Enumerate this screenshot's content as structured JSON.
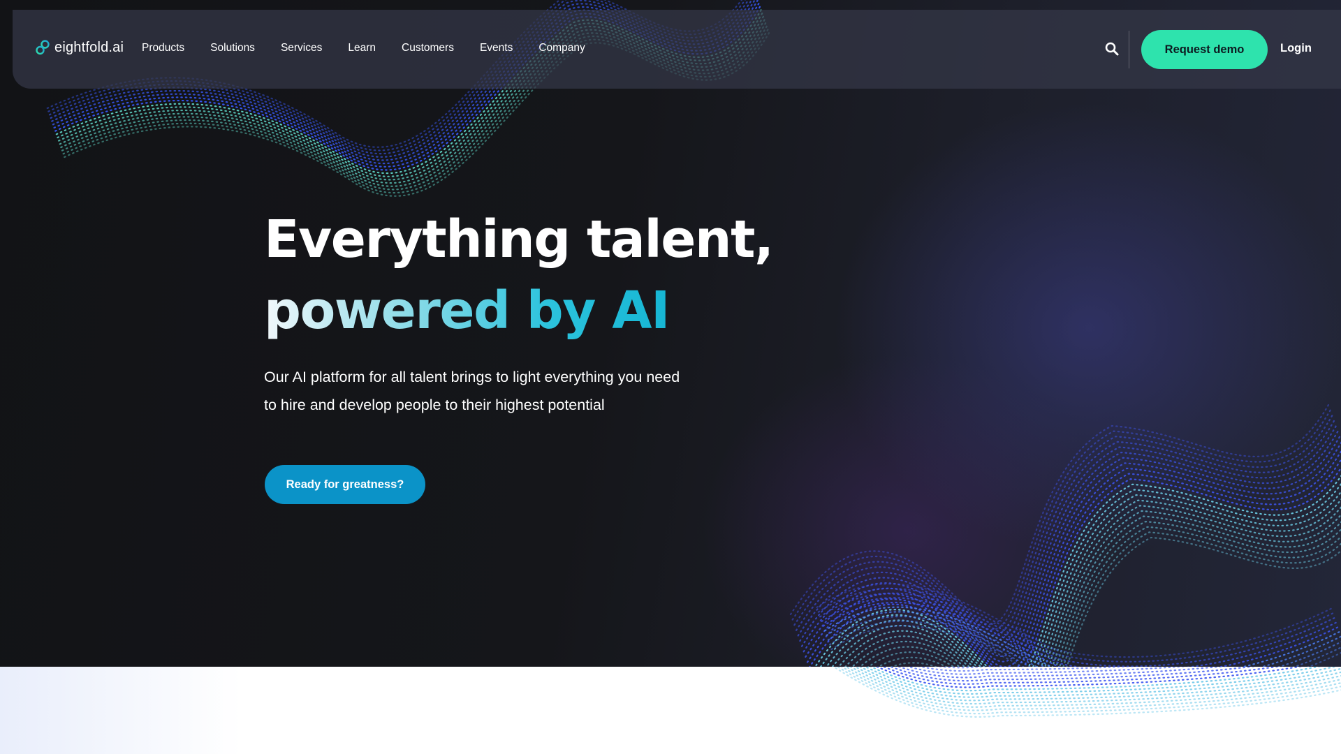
{
  "brand": {
    "name": "eightfold.ai",
    "accent": "#2ee3ad",
    "cta_color": "#0b93c8"
  },
  "nav": {
    "items": [
      {
        "label": "Products"
      },
      {
        "label": "Solutions"
      },
      {
        "label": "Services"
      },
      {
        "label": "Learn"
      },
      {
        "label": "Customers"
      },
      {
        "label": "Events"
      },
      {
        "label": "Company"
      }
    ],
    "search_icon": "search-icon",
    "request_demo_label": "Request demo",
    "login_label": "Login"
  },
  "hero": {
    "headline_line1": "Everything talent,",
    "headline_line2": "powered by AI",
    "description": "Our AI platform for all talent brings to light everything you need to hire and develop people to their highest potential",
    "cta_label": "Ready for greatness?"
  }
}
